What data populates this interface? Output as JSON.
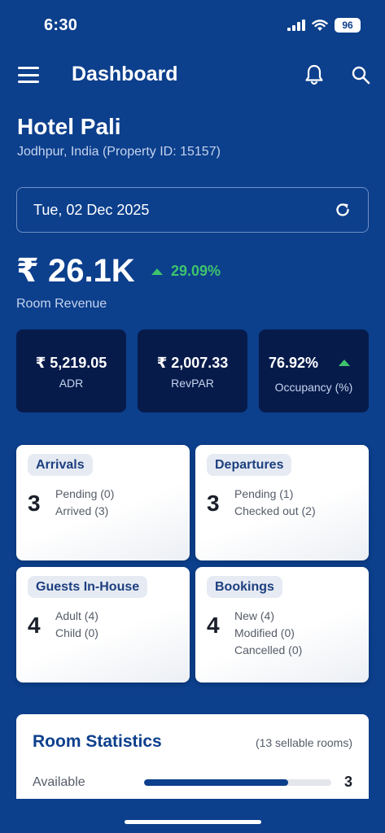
{
  "status_bar": {
    "time": "6:30",
    "battery": "96"
  },
  "header": {
    "title": "Dashboard"
  },
  "hotel": {
    "name": "Hotel Pali",
    "subtitle": "Jodhpur, India (Property ID: 15157)"
  },
  "date_picker": {
    "value": "Tue, 02 Dec 2025"
  },
  "revenue": {
    "value": "₹ 26.1K",
    "change": "29.09%",
    "label": "Room Revenue",
    "change_color": "#3ec46d"
  },
  "kpis": [
    {
      "value": "₹ 5,219.05",
      "label": "ADR"
    },
    {
      "value": "₹ 2,007.33",
      "label": "RevPAR"
    },
    {
      "value": "76.92%",
      "label": "Occupancy (%)"
    }
  ],
  "cards": [
    {
      "title": "Arrivals",
      "count": "3",
      "lines": [
        "Pending (0)",
        "Arrived (3)"
      ]
    },
    {
      "title": "Departures",
      "count": "3",
      "lines": [
        "Pending (1)",
        "Checked out (2)"
      ]
    },
    {
      "title": "Guests In-House",
      "count": "4",
      "lines": [
        "Adult (4)",
        "Child (0)"
      ]
    },
    {
      "title": "Bookings",
      "count": "4",
      "lines": [
        "New (4)",
        "Modified (0)",
        "Cancelled (0)"
      ]
    }
  ],
  "room_stats": {
    "title": "Room Statistics",
    "subtitle": "(13 sellable rooms)",
    "rows": [
      {
        "label": "Available",
        "value": "3",
        "fill_percent": 77
      }
    ]
  },
  "colors": {
    "background": "#0c3f8c",
    "kpi_bg": "#071b4b",
    "accent_green": "#3ec46d"
  },
  "icons": [
    "signal-icon",
    "wifi-icon",
    "menu-icon",
    "bell-icon",
    "search-icon",
    "refresh-icon",
    "arrow-up-icon"
  ]
}
